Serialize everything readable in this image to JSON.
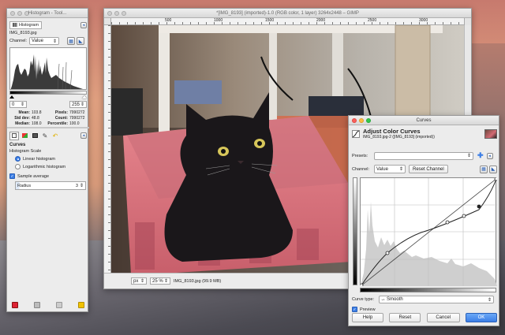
{
  "toolbox": {
    "title": "Histogram - Tool...",
    "tab_label": "Histogram",
    "image_name": "IMG_8193.jpg",
    "channel_label": "Channel:",
    "channel_value": "Value",
    "range_min": "0",
    "range_max": "255",
    "stats": [
      {
        "label": "Mean:",
        "value": "103.8"
      },
      {
        "label": "Pixels:",
        "value": "7990272"
      },
      {
        "label": "Std dev:",
        "value": "48.8"
      },
      {
        "label": "Count:",
        "value": "7990272"
      },
      {
        "label": "Median:",
        "value": "108.0"
      },
      {
        "label": "Percentile:",
        "value": "100.0"
      }
    ],
    "curves_heading": "Curves",
    "histogram_scale_label": "Histogram Scale",
    "linear_label": "Linear histogram",
    "log_label": "Logarithmic histogram",
    "sample_average_label": "Sample average",
    "radius_label": "Radius",
    "radius_value": "3"
  },
  "image_window": {
    "title": "*[IMG_8193] (imported)-1.0 (RGB color, 1 layer) 3264x2448 – GIMP",
    "ruler_labels": [
      "500",
      "1000",
      "1500",
      "2000",
      "2500",
      "3000"
    ],
    "unit": "px",
    "zoom": "25 %",
    "status": "IMG_8193.jpg (99.9 MB)"
  },
  "curves": {
    "window_title": "Curves",
    "heading": "Adjust Color Curves",
    "subheading": "IMG_8193.jpg-2 ([IMG_8193] (imported))",
    "presets_label": "Presets:",
    "channel_label": "Channel:",
    "channel_value": "Value",
    "reset_channel_label": "Reset Channel",
    "curve_type_label": "Curve type:",
    "curve_type_value": "Smooth",
    "preview_label": "Preview",
    "help_label": "Help",
    "reset_label": "Reset",
    "cancel_label": "Cancel",
    "ok_label": "OK"
  },
  "colors": {
    "accent": "#3b7ee6",
    "crate": "#e37d88",
    "cat": "#1a171a"
  }
}
